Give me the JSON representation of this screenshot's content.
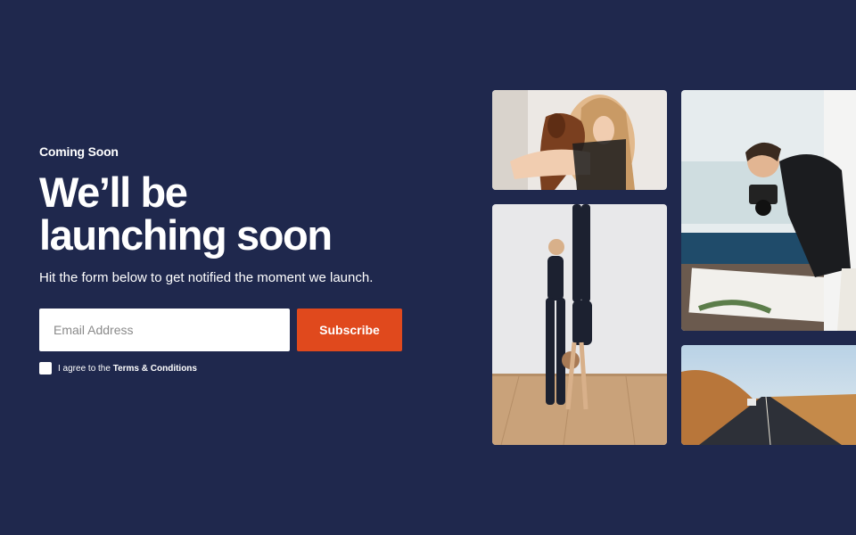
{
  "hero": {
    "eyebrow": "Coming Soon",
    "headline_line1": "We’ll be",
    "headline_line2": "launching soon",
    "subtext": "Hit the form below to get notified the moment we launch."
  },
  "form": {
    "email_placeholder": "Email Address",
    "subscribe_label": "Subscribe",
    "agree_prefix": "I agree to the",
    "terms_link": "Terms & Conditions"
  },
  "colors": {
    "background": "#1f284d",
    "accent": "#e0491d"
  },
  "gallery": {
    "photos": [
      "woman-with-dog-photo",
      "yoga-handstand-photo",
      "photographer-with-camera-photo",
      "desert-road-photo"
    ]
  }
}
